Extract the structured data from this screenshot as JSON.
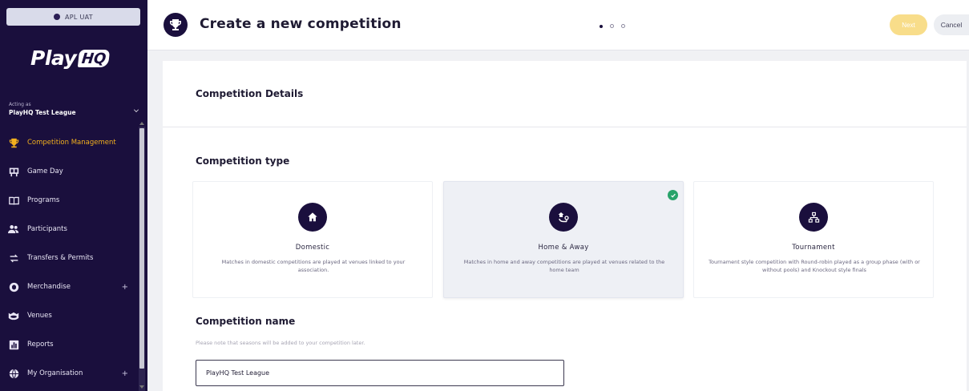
{
  "env": {
    "label": "APL UAT"
  },
  "brand": {
    "name": "Play",
    "badge": "HQ"
  },
  "org": {
    "acting_as_label": "Acting as",
    "name": "PlayHQ Test League"
  },
  "nav": {
    "items": [
      {
        "label": "Competition Management",
        "icon": "trophy-icon",
        "active": true
      },
      {
        "label": "Game Day",
        "icon": "scoreboard-icon"
      },
      {
        "label": "Programs",
        "icon": "book-icon"
      },
      {
        "label": "Participants",
        "icon": "people-icon"
      },
      {
        "label": "Transfers & Permits",
        "icon": "transfer-icon"
      },
      {
        "label": "Merchandise",
        "icon": "merchandise-icon",
        "expandable": true
      },
      {
        "label": "Venues",
        "icon": "stadium-icon"
      },
      {
        "label": "Reports",
        "icon": "reports-icon"
      },
      {
        "label": "My Organisation",
        "icon": "globe-icon",
        "expandable": true
      }
    ],
    "expand_symbol": "+"
  },
  "header": {
    "title": "Create a new competition",
    "icon": "trophy-icon",
    "steps": {
      "current": 1,
      "total": 3
    },
    "next_label": "Next",
    "cancel_label": "Cancel"
  },
  "main": {
    "details_title": "Competition Details",
    "type_title": "Competition type",
    "types": [
      {
        "title": "Domestic",
        "icon": "home-icon",
        "description": "Matches in domestic competitions are played at venues linked to your association.",
        "selected": false
      },
      {
        "title": "Home & Away",
        "icon": "home-away-icon",
        "description": "Matches in home and away competitions are played at venues related to the home team",
        "selected": true
      },
      {
        "title": "Tournament",
        "icon": "bracket-icon",
        "description": "Tournament style competition with Round-robin played as a group phase (with or without pools) and Knockout style finals",
        "selected": false
      }
    ],
    "name_title": "Competition name",
    "name_hint": "Please note that seasons will be added to your competition later.",
    "name_value": "PlayHQ Test League"
  },
  "colors": {
    "sidebar": "#1a0f3d",
    "accent": "#f2b01e",
    "success": "#29a36a",
    "next_button": "#f8dd8a"
  }
}
